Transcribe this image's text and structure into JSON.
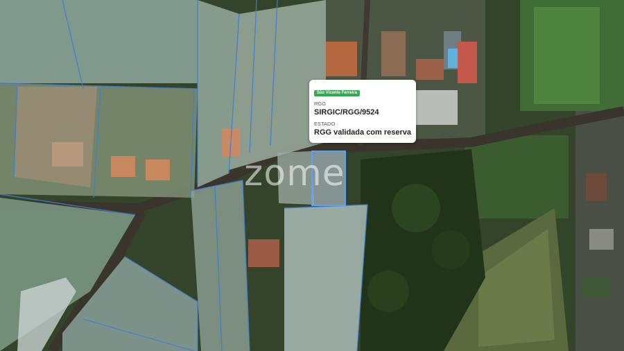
{
  "popup": {
    "area_badge": "São Vicente Ferreira",
    "field1_label": "RGG",
    "field1_value": "SIRGIC/RGG/9524",
    "field2_label": "ESTADO",
    "field2_value": "RGG validada com reserva",
    "badge_color": "#34a853"
  },
  "watermark": {
    "text": "zome",
    "logo_name": "zome-logo-watermark"
  },
  "map": {
    "parcel_border_color": "#3d7fd1",
    "selected_parcel_color": "#5aa0ff"
  }
}
